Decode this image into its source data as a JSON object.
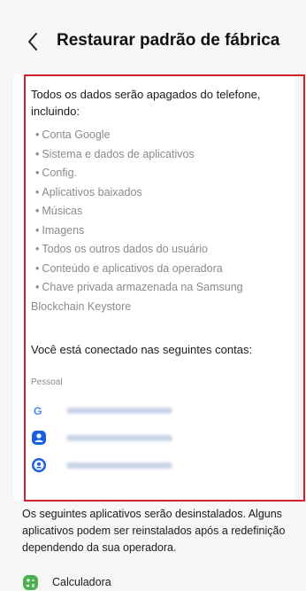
{
  "header": {
    "back_icon": "chevron-left-icon",
    "title": "Restaurar padrão de fábrica"
  },
  "content": {
    "intro": "Todos os dados serão apagados do telefone, incluindo:",
    "items": [
      "Conta Google",
      "Sistema e dados de aplicativos",
      "Config.",
      "Aplicativos baixados",
      "Músicas",
      "Imagens",
      "Todos os outros dados do usuário",
      "Conteúdo e aplicativos da operadora",
      "Chave privada armazenada na Samsung"
    ],
    "item_continuation": "Blockchain Keystore",
    "connected_label": "Você está conectado nas seguintes contas:",
    "section_label": "Pessoal",
    "accounts": [
      {
        "icon": "google-icon",
        "color": "#4285f4"
      },
      {
        "icon": "samsung-account-icon",
        "color": "#1a5fdc"
      },
      {
        "icon": "samsung-account-icon",
        "color": "#1a5fdc"
      }
    ]
  },
  "uninstall": {
    "text": "Os seguintes aplicativos serão desinstalados. Alguns aplicativos podem ser reinstalados após a redefinição dependendo da sua operadora.",
    "apps": [
      {
        "label": "Calculadora",
        "icon": "calculator-icon",
        "color": "#4caf50"
      }
    ]
  },
  "colors": {
    "highlight_frame": "#d4202a",
    "background": "#f6f6f6",
    "card": "#ffffff"
  }
}
